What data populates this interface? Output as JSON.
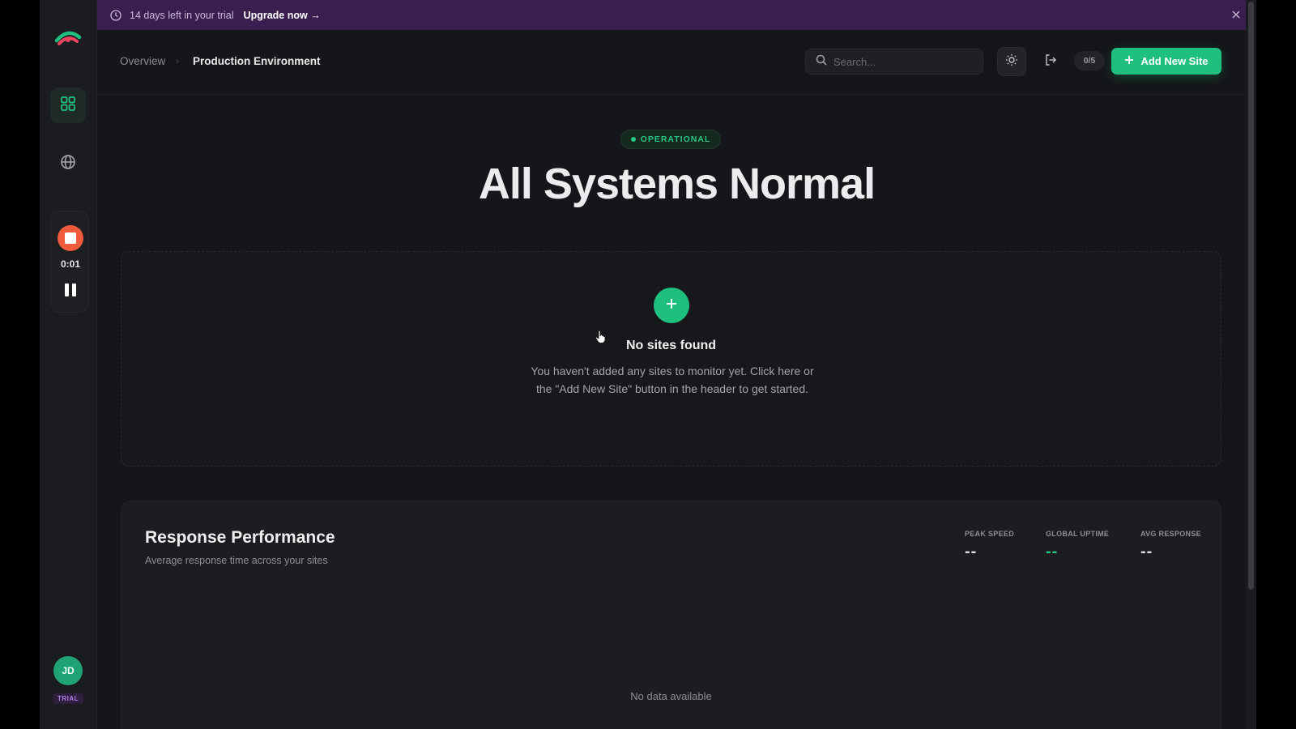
{
  "banner": {
    "trial_text": "14 days left in your trial",
    "upgrade_label": "Upgrade now →"
  },
  "breadcrumb": {
    "overview": "Overview",
    "separator": "›",
    "current": "Production Environment"
  },
  "header": {
    "search_placeholder": "Search...",
    "site_count": "0/5",
    "add_button_label": "Add New Site"
  },
  "recorder": {
    "elapsed": "0:01"
  },
  "user": {
    "initials": "JD",
    "plan_badge": "TRIAL"
  },
  "hero": {
    "status_label": "OPERATIONAL",
    "title": "All Systems Normal"
  },
  "empty_state": {
    "title": "No sites found",
    "description": "You haven't added any sites to monitor yet. Click here or the \"Add New Site\" button in the header to get started."
  },
  "performance": {
    "title": "Response Performance",
    "subtitle": "Average response time across your sites",
    "stats": [
      {
        "label": "PEAK SPEED",
        "value": "--"
      },
      {
        "label": "GLOBAL UPTIME",
        "value": "--"
      },
      {
        "label": "AVG RESPONSE",
        "value": "--"
      }
    ],
    "empty_label": "No data available"
  },
  "colors": {
    "accent": "#1fbf7e",
    "banner_bg": "#3a1e4f",
    "record_red": "#f05a3d",
    "background": "#151619"
  }
}
